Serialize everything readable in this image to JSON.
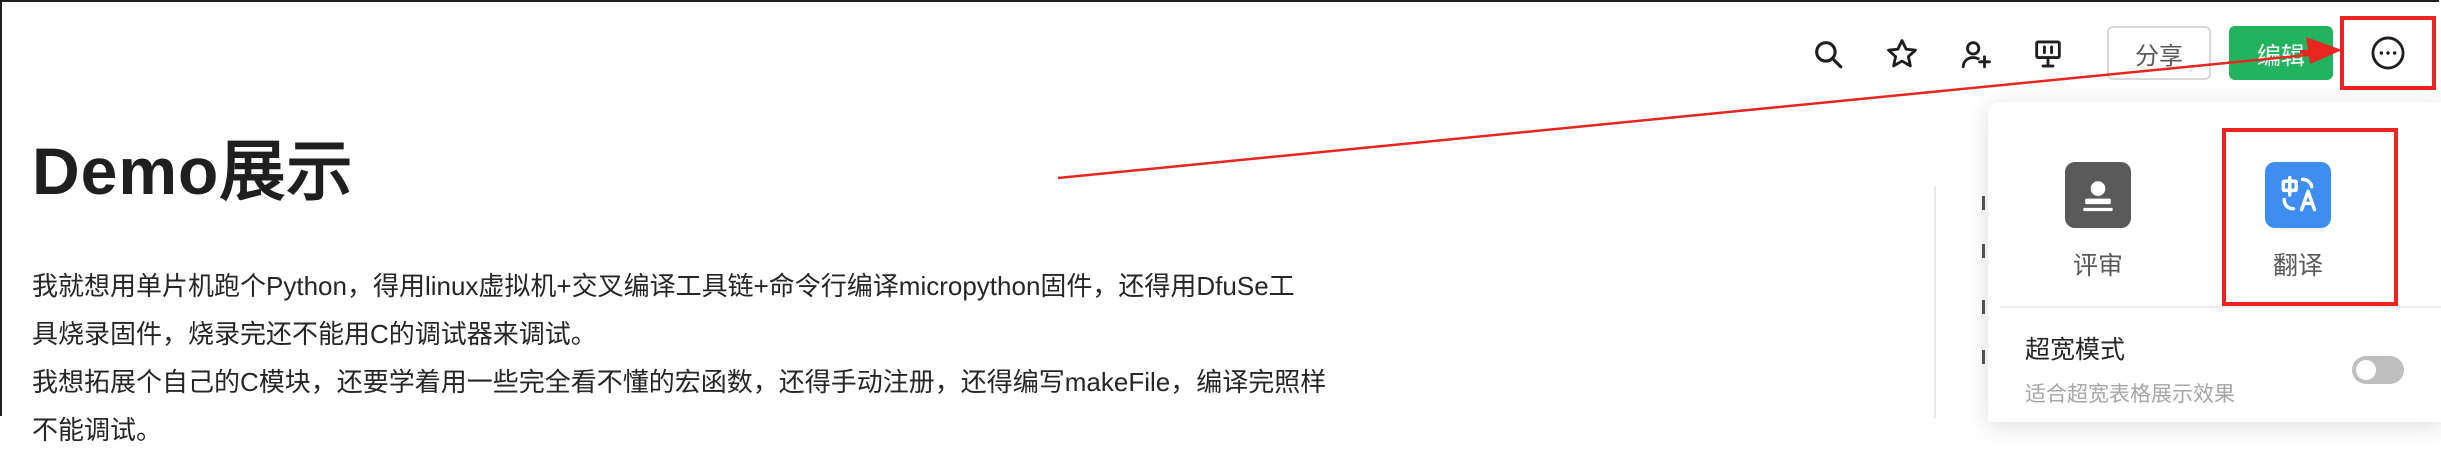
{
  "toolbar": {
    "icons": [
      "search-icon",
      "star-icon",
      "add-user-icon",
      "presentation-icon"
    ],
    "share_label": "分享",
    "edit_label": "编辑",
    "more_icon": "more-icon"
  },
  "document": {
    "title": "Demo展示",
    "paragraphs": [
      "我就想用单片机跑个Python，得用linux虚拟机+交叉编译工具链+命令行编译micropython固件，还得用DfuSe工",
      "具烧录固件，烧录完还不能用C的调试器来调试。",
      "我想拓展个自己的C模块，还要学着用一些完全看不懂的宏函数，还得手动注册，还得编写makeFile，编译完照样",
      "不能调试。"
    ]
  },
  "menu": {
    "items": [
      {
        "label": "评审",
        "icon": "review-icon",
        "color": "#5a5a5a"
      },
      {
        "label": "翻译",
        "icon": "translate-icon",
        "color": "#3d8ef0"
      }
    ],
    "wide_mode": {
      "label": "超宽模式",
      "description": "适合超宽表格展示效果",
      "enabled": false
    }
  },
  "colors": {
    "accent_green": "#22b35e",
    "highlight_red": "#e8261f"
  }
}
